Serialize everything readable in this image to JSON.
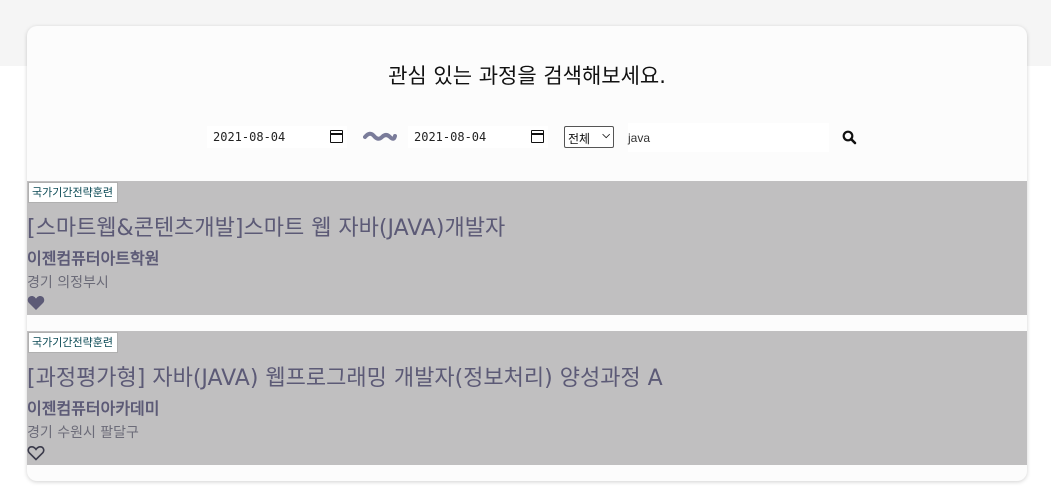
{
  "header": {
    "title": "관심 있는 과정을 검색해보세요."
  },
  "search": {
    "start_date": "2021-08-04",
    "end_date": "2021-08-04",
    "category": "전체",
    "keyword": "java"
  },
  "results": [
    {
      "badge": "국가기간전략훈련",
      "title": "[스마트웹&콘텐츠개발]스마트 웹 자바(JAVA)개발자",
      "org": "이젠컴퓨터아트학원",
      "location": "경기 의정부시",
      "favorited": true
    },
    {
      "badge": "국가기간전략훈련",
      "title": "[과정평가형] 자바(JAVA) 웹프로그래밍 개발자(정보처리) 양성과정 A",
      "org": "이젠컴퓨터아카데미",
      "location": "경기 수원시 팔달구",
      "favorited": false
    }
  ],
  "colors": {
    "card_bg": "#fcfcfc",
    "result_bg": "#c0bfc0",
    "title_text": "#5c5a76",
    "badge_text": "#0b4a55"
  }
}
